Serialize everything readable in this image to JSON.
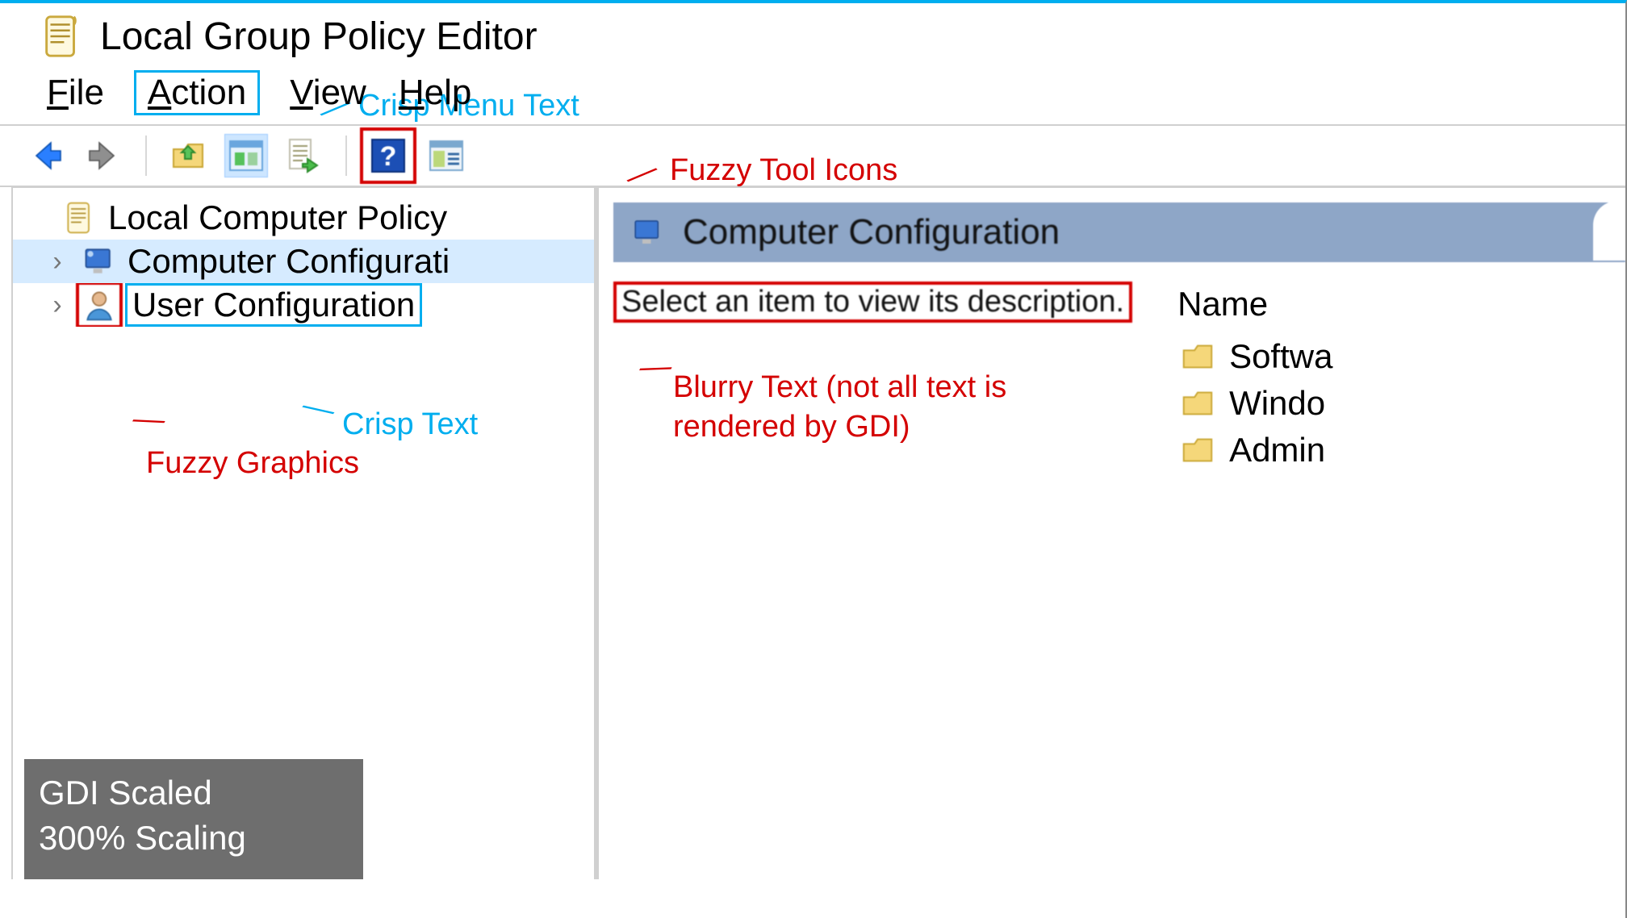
{
  "app": {
    "title": "Local Group Policy Editor"
  },
  "menu": {
    "items": [
      "File",
      "Action",
      "View",
      "Help"
    ]
  },
  "annotations": {
    "crisp_menu": "Crisp Menu Text",
    "fuzzy_tool_icons": "Fuzzy Tool Icons",
    "crisp_text": "Crisp Text",
    "fuzzy_graphics": "Fuzzy Graphics",
    "blurry_text": "Blurry Text (not all text is rendered by GDI)"
  },
  "toolbar": {
    "icons": [
      "back-icon",
      "forward-icon",
      "up-folder-icon",
      "properties-icon",
      "export-list-icon",
      "help-icon",
      "show-hide-tree-icon"
    ]
  },
  "tree": {
    "root_label": "Local Computer Policy",
    "children": [
      {
        "label": "Computer Configurati",
        "icon": "computer-config-icon",
        "selected": true
      },
      {
        "label": "User Configuration",
        "icon": "user-config-icon",
        "selected": false
      }
    ]
  },
  "details": {
    "header": "Computer Configuration",
    "description": "Select an item to view its description.",
    "name_column": "Name",
    "items": [
      "Softwa",
      "Windo",
      "Admin"
    ]
  },
  "caption": {
    "line1": "GDI Scaled",
    "line2": "300% Scaling"
  }
}
